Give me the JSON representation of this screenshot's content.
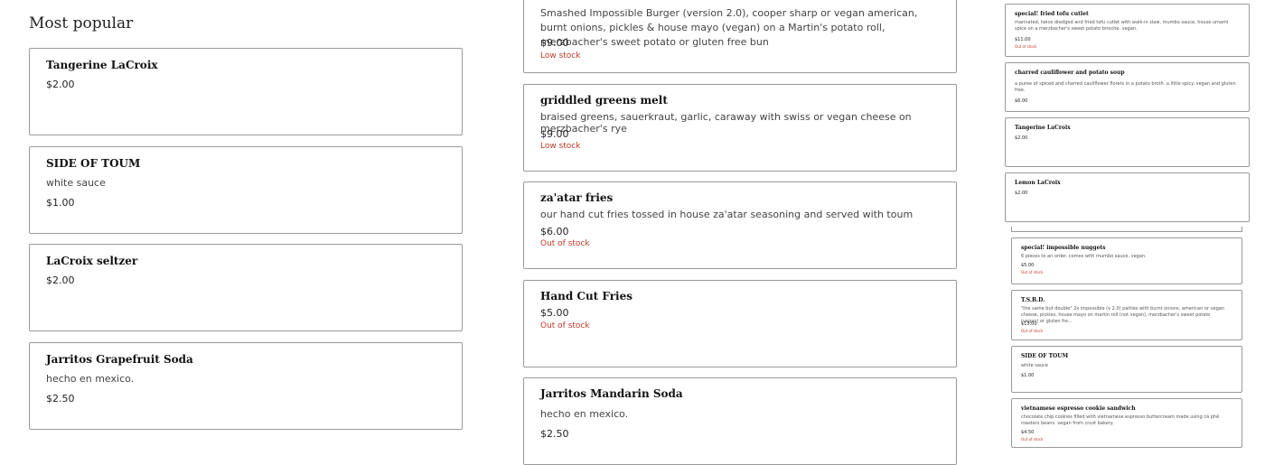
{
  "left": {
    "title": "Most popular",
    "items": [
      {
        "name": "Tangerine LaCroix",
        "price": "$2.00"
      },
      {
        "name": "SIDE OF TOUM",
        "desc": "white sauce",
        "price": "$1.00"
      },
      {
        "name": "LaCroix seltzer",
        "price": "$2.00"
      },
      {
        "name": "Jarritos Grapefruit Soda",
        "desc": "hecho en mexico.",
        "price": "$2.50"
      }
    ]
  },
  "middle": {
    "items": [
      {
        "desc": "Smashed Impossible Burger (version 2.0), cooper sharp or vegan american, burnt onions, pickles & house mayo (vegan) on a Martin's potato roll, merzbacher's sweet potato or gluten free bun",
        "price": "$9.00",
        "stock": "Low stock"
      },
      {
        "name": "griddled greens melt",
        "desc": "braised greens, sauerkraut, garlic, caraway with swiss or vegan cheese on merzbacher's rye",
        "price": "$9.00",
        "stock": "Low stock"
      },
      {
        "name": "za'atar fries",
        "desc": "our hand cut fries tossed in house za'atar seasoning and served with toum",
        "price": "$6.00",
        "stock": "Out of stock"
      },
      {
        "name": "Hand Cut Fries",
        "price": "$5.00",
        "stock": "Out of stock"
      },
      {
        "name": "Jarritos Mandarin Soda",
        "desc": "hecho en mexico.",
        "price": "$2.50"
      }
    ]
  },
  "right": {
    "items": [
      {
        "name": "special! fried tofu cutlet",
        "desc": "marinated, twice dredged and fried tofu cutlet with walk-in slaw, mumbo sauce, house umami spice on a merzbacher's sweet potato brioche. vegan.",
        "price": "$11.00",
        "stock": "Out of stock"
      },
      {
        "name": "charred cauliflower and potato soup",
        "desc": "a puree of spiced and charred cauliflower florets in a potato broth. a little spicy. vegan and gluten free.",
        "price": "$6.00"
      },
      {
        "name": "Tangerine LaCroix",
        "price": "$2.00"
      },
      {
        "name": "Lemon LaCroix",
        "price": "$2.00"
      },
      {
        "name": "special! impossible nuggets",
        "desc": "6 pieces to an order. comes with mumbo sauce. vegan.",
        "price": "$5.00",
        "stock": "Out of stock"
      },
      {
        "name": "T.S.B.D.",
        "desc": "\"the same but double\" 2x impossible (v 2.0) patties with burnt onions, american or vegan cheese, pickles, house mayo on martin roll (not vegan), merzbacher's sweet potato (vegan) or gluten fre...",
        "price": "$13.00",
        "stock": "Out of stock"
      },
      {
        "name": "SIDE OF TOUM",
        "desc": "white sauce",
        "price": "$1.00"
      },
      {
        "name": "vietnamese espresso cookie sandwich",
        "desc": "chocolate chip cookies filled with vietnamese espresso buttercream made using cà phê roasters beans. vegan from crust bakery.",
        "price": "$4.50",
        "stock": "Out of stock"
      }
    ]
  }
}
